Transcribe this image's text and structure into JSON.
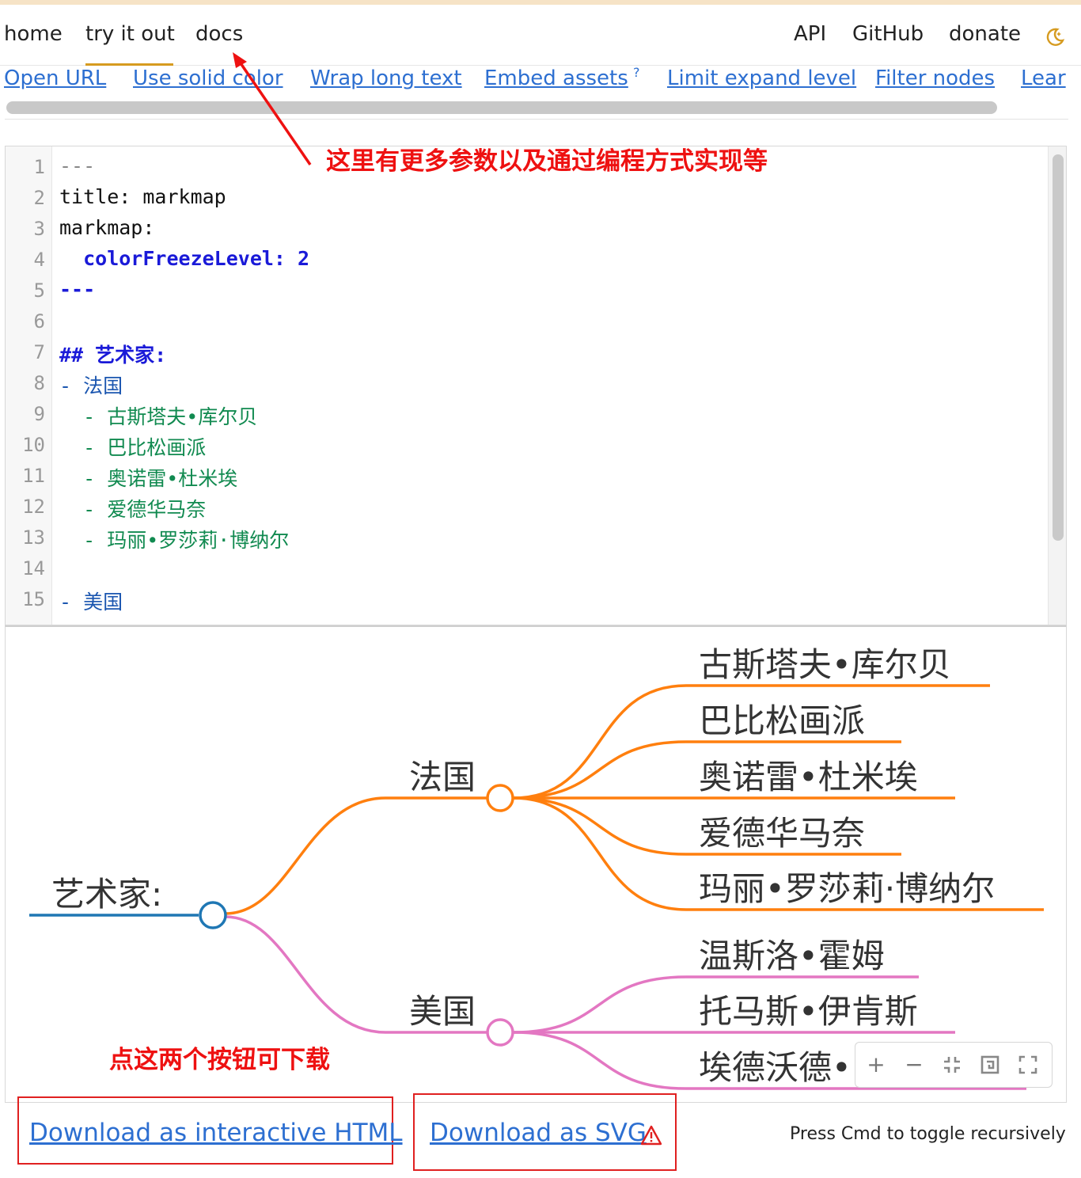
{
  "nav": {
    "left": [
      "home",
      "try it out",
      "docs"
    ],
    "right": [
      "API",
      "GitHub",
      "donate"
    ],
    "theme_icon": "moon-icon"
  },
  "links": [
    "Open URL",
    "Use solid color",
    "Wrap long text",
    "Embed assets",
    "Limit expand level",
    "Filter nodes",
    "Lear"
  ],
  "embed_assets_mark": "?",
  "editor": {
    "line_numbers": [
      "1",
      "2",
      "3",
      "4",
      "5",
      "6",
      "7",
      "8",
      "9",
      "10",
      "11",
      "12",
      "13",
      "14",
      "15"
    ],
    "lines": [
      "---",
      "title: markmap",
      "markmap:",
      "  colorFreezeLevel: 2",
      "---",
      "",
      "## 艺术家:",
      "- 法国",
      "  - 古斯塔夫•库尔贝",
      "  - 巴比松画派",
      "  - 奥诺雷•杜米埃",
      "  - 爱德华马奈",
      "  - 玛丽•罗莎莉·博纳尔",
      "",
      "- 美国"
    ]
  },
  "mindmap": {
    "root": "艺术家:",
    "branch_france": "法国",
    "branch_usa": "美国",
    "france_children": [
      "古斯塔夫•库尔贝",
      "巴比松画派",
      "奥诺雷•杜米埃",
      "爱德华马奈",
      "玛丽•罗莎莉·博纳尔"
    ],
    "usa_children": [
      "温斯洛•霍姆",
      "托马斯•伊肯斯",
      "埃德沃德•"
    ],
    "colors": {
      "root": "#1f77b4",
      "france": "#ff7f0e",
      "usa": "#e377c2"
    }
  },
  "toolbar": {
    "zoom_in": "+",
    "zoom_out": "−"
  },
  "annotations": {
    "docs_note": "这里有更多参数以及通过编程方式实现等",
    "download_note": "点这两个按钮可下载"
  },
  "downloads": {
    "html": "Download as interactive HTML",
    "svg": "Download as SVG",
    "warning_icon": "warning-icon"
  },
  "hint": "Press Cmd to toggle recursively"
}
